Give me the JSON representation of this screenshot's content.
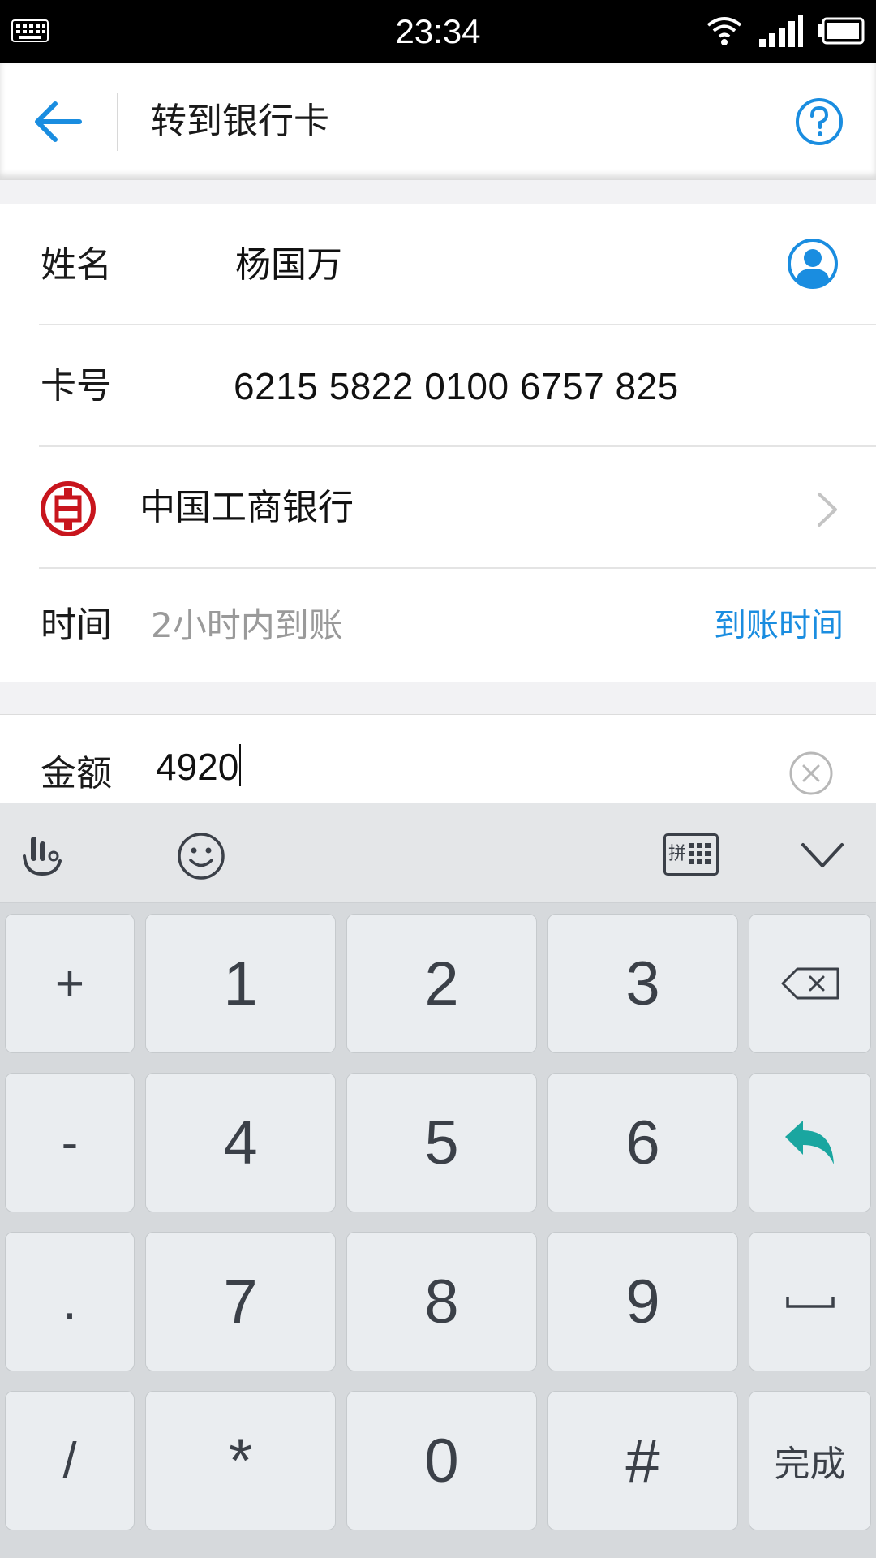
{
  "status_bar": {
    "time": "23:34"
  },
  "header": {
    "title": "转到银行卡"
  },
  "form": {
    "name_label": "姓名",
    "name_value": "杨国万",
    "card_label": "卡号",
    "card_value": "6215 5822 0100 6757 825",
    "bank_name": "中国工商银行",
    "time_label": "时间",
    "time_hint": "2小时内到账",
    "time_link": "到账时间",
    "amount_label": "金额",
    "amount_value": "4920"
  },
  "keyboard": {
    "side_keys": [
      "+",
      "-",
      ".",
      "/"
    ],
    "rows": [
      [
        "1",
        "2",
        "3"
      ],
      [
        "4",
        "5",
        "6"
      ],
      [
        "7",
        "8",
        "9"
      ],
      [
        "*",
        "0",
        "#"
      ]
    ],
    "toolbar_layout_badge": "拼",
    "done_label": "完成"
  },
  "colors": {
    "accent_blue": "#1a8de0",
    "bank_red": "#c8151d",
    "enter_teal": "#1aa6a0"
  }
}
